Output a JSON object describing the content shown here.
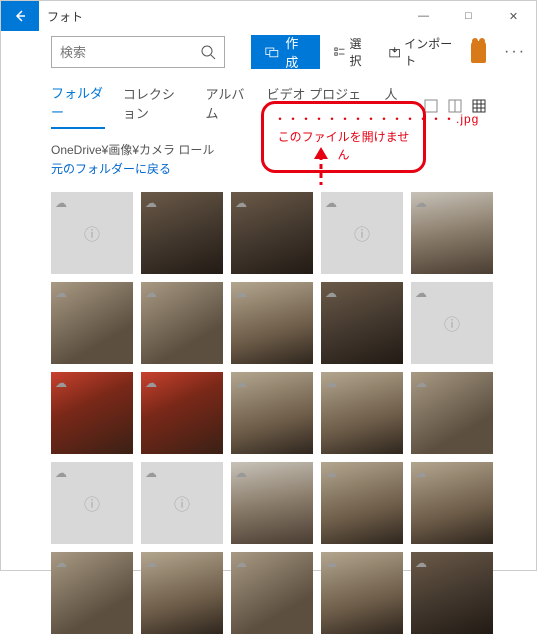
{
  "window": {
    "title": "フォト",
    "min": "—",
    "max": "□",
    "close": "✕"
  },
  "toolbar": {
    "search_placeholder": "検索",
    "create_label": "作成",
    "select_label": "選択",
    "import_label": "インポート"
  },
  "tabs": {
    "folder": "フォルダー",
    "collection": "コレクション",
    "album": "アルバム",
    "video": "ビデオ プロジェクト",
    "people": "人物"
  },
  "breadcrumb": {
    "path": "OneDrive¥画像¥カメラ ロール",
    "back_link": "元のフォルダーに戻る"
  },
  "annotation": {
    "line1": "・・・・・・・・・・・・・・.jpg",
    "line2": "このファイルを開けません"
  },
  "thumbs": [
    {
      "type": "placeholder",
      "cloud": true
    },
    {
      "type": "photo",
      "class": "photo1",
      "cloud": true
    },
    {
      "type": "photo",
      "class": "photo1",
      "cloud": true
    },
    {
      "type": "placeholder",
      "cloud": true
    },
    {
      "type": "photo",
      "class": "photo2",
      "cloud": true
    },
    {
      "type": "photo",
      "class": "photo3",
      "cloud": true
    },
    {
      "type": "photo",
      "class": "photo3",
      "cloud": true
    },
    {
      "type": "photo",
      "class": "photo4",
      "cloud": true
    },
    {
      "type": "photo",
      "class": "photo1",
      "cloud": true
    },
    {
      "type": "placeholder",
      "cloud": true
    },
    {
      "type": "photo",
      "class": "photo5",
      "cloud": true
    },
    {
      "type": "photo",
      "class": "photo5",
      "cloud": true
    },
    {
      "type": "photo",
      "class": "photo4",
      "cloud": true
    },
    {
      "type": "photo",
      "class": "photo4",
      "cloud": true
    },
    {
      "type": "photo",
      "class": "photo3",
      "cloud": true
    },
    {
      "type": "placeholder",
      "cloud": true
    },
    {
      "type": "placeholder",
      "cloud": true
    },
    {
      "type": "photo",
      "class": "photo2",
      "cloud": true
    },
    {
      "type": "photo",
      "class": "photo4",
      "cloud": true
    },
    {
      "type": "photo",
      "class": "photo4",
      "cloud": true
    },
    {
      "type": "photo",
      "class": "photo3",
      "cloud": true
    },
    {
      "type": "photo",
      "class": "photo4",
      "cloud": true
    },
    {
      "type": "photo",
      "class": "photo3",
      "cloud": true
    },
    {
      "type": "photo",
      "class": "photo4",
      "cloud": true
    },
    {
      "type": "photo",
      "class": "photo1",
      "cloud": true
    }
  ]
}
